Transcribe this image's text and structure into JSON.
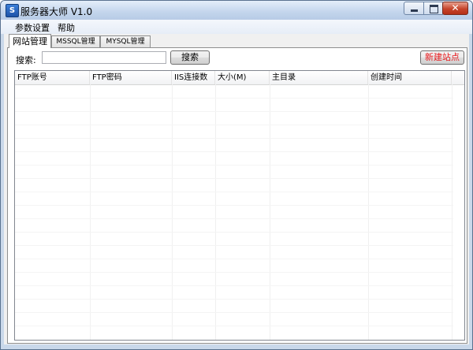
{
  "window": {
    "title": "服务器大师 V1.0",
    "icon": "app-logo-icon",
    "icon_letter": "S",
    "controls": {
      "minimize": "minimize-icon",
      "maximize": "maximize-icon",
      "close": "close-icon",
      "close_glyph": "✕"
    }
  },
  "menu": [
    {
      "label": "参数设置"
    },
    {
      "label": "帮助"
    }
  ],
  "tabs": [
    {
      "label": "网站管理",
      "active": true
    },
    {
      "label": "MSSQL管理",
      "active": false
    },
    {
      "label": "MYSQL管理",
      "active": false
    }
  ],
  "toolbar": {
    "search_label": "搜索:",
    "search_value": "",
    "search_placeholder": "",
    "search_button": "搜索",
    "new_site_button": "新建站点",
    "new_site_color": "#e8191c"
  },
  "table": {
    "columns": [
      "FTP账号",
      "FTP密码",
      "IIS连接数",
      "大小(M)",
      "主目录",
      "创建时间"
    ],
    "rows": []
  }
}
